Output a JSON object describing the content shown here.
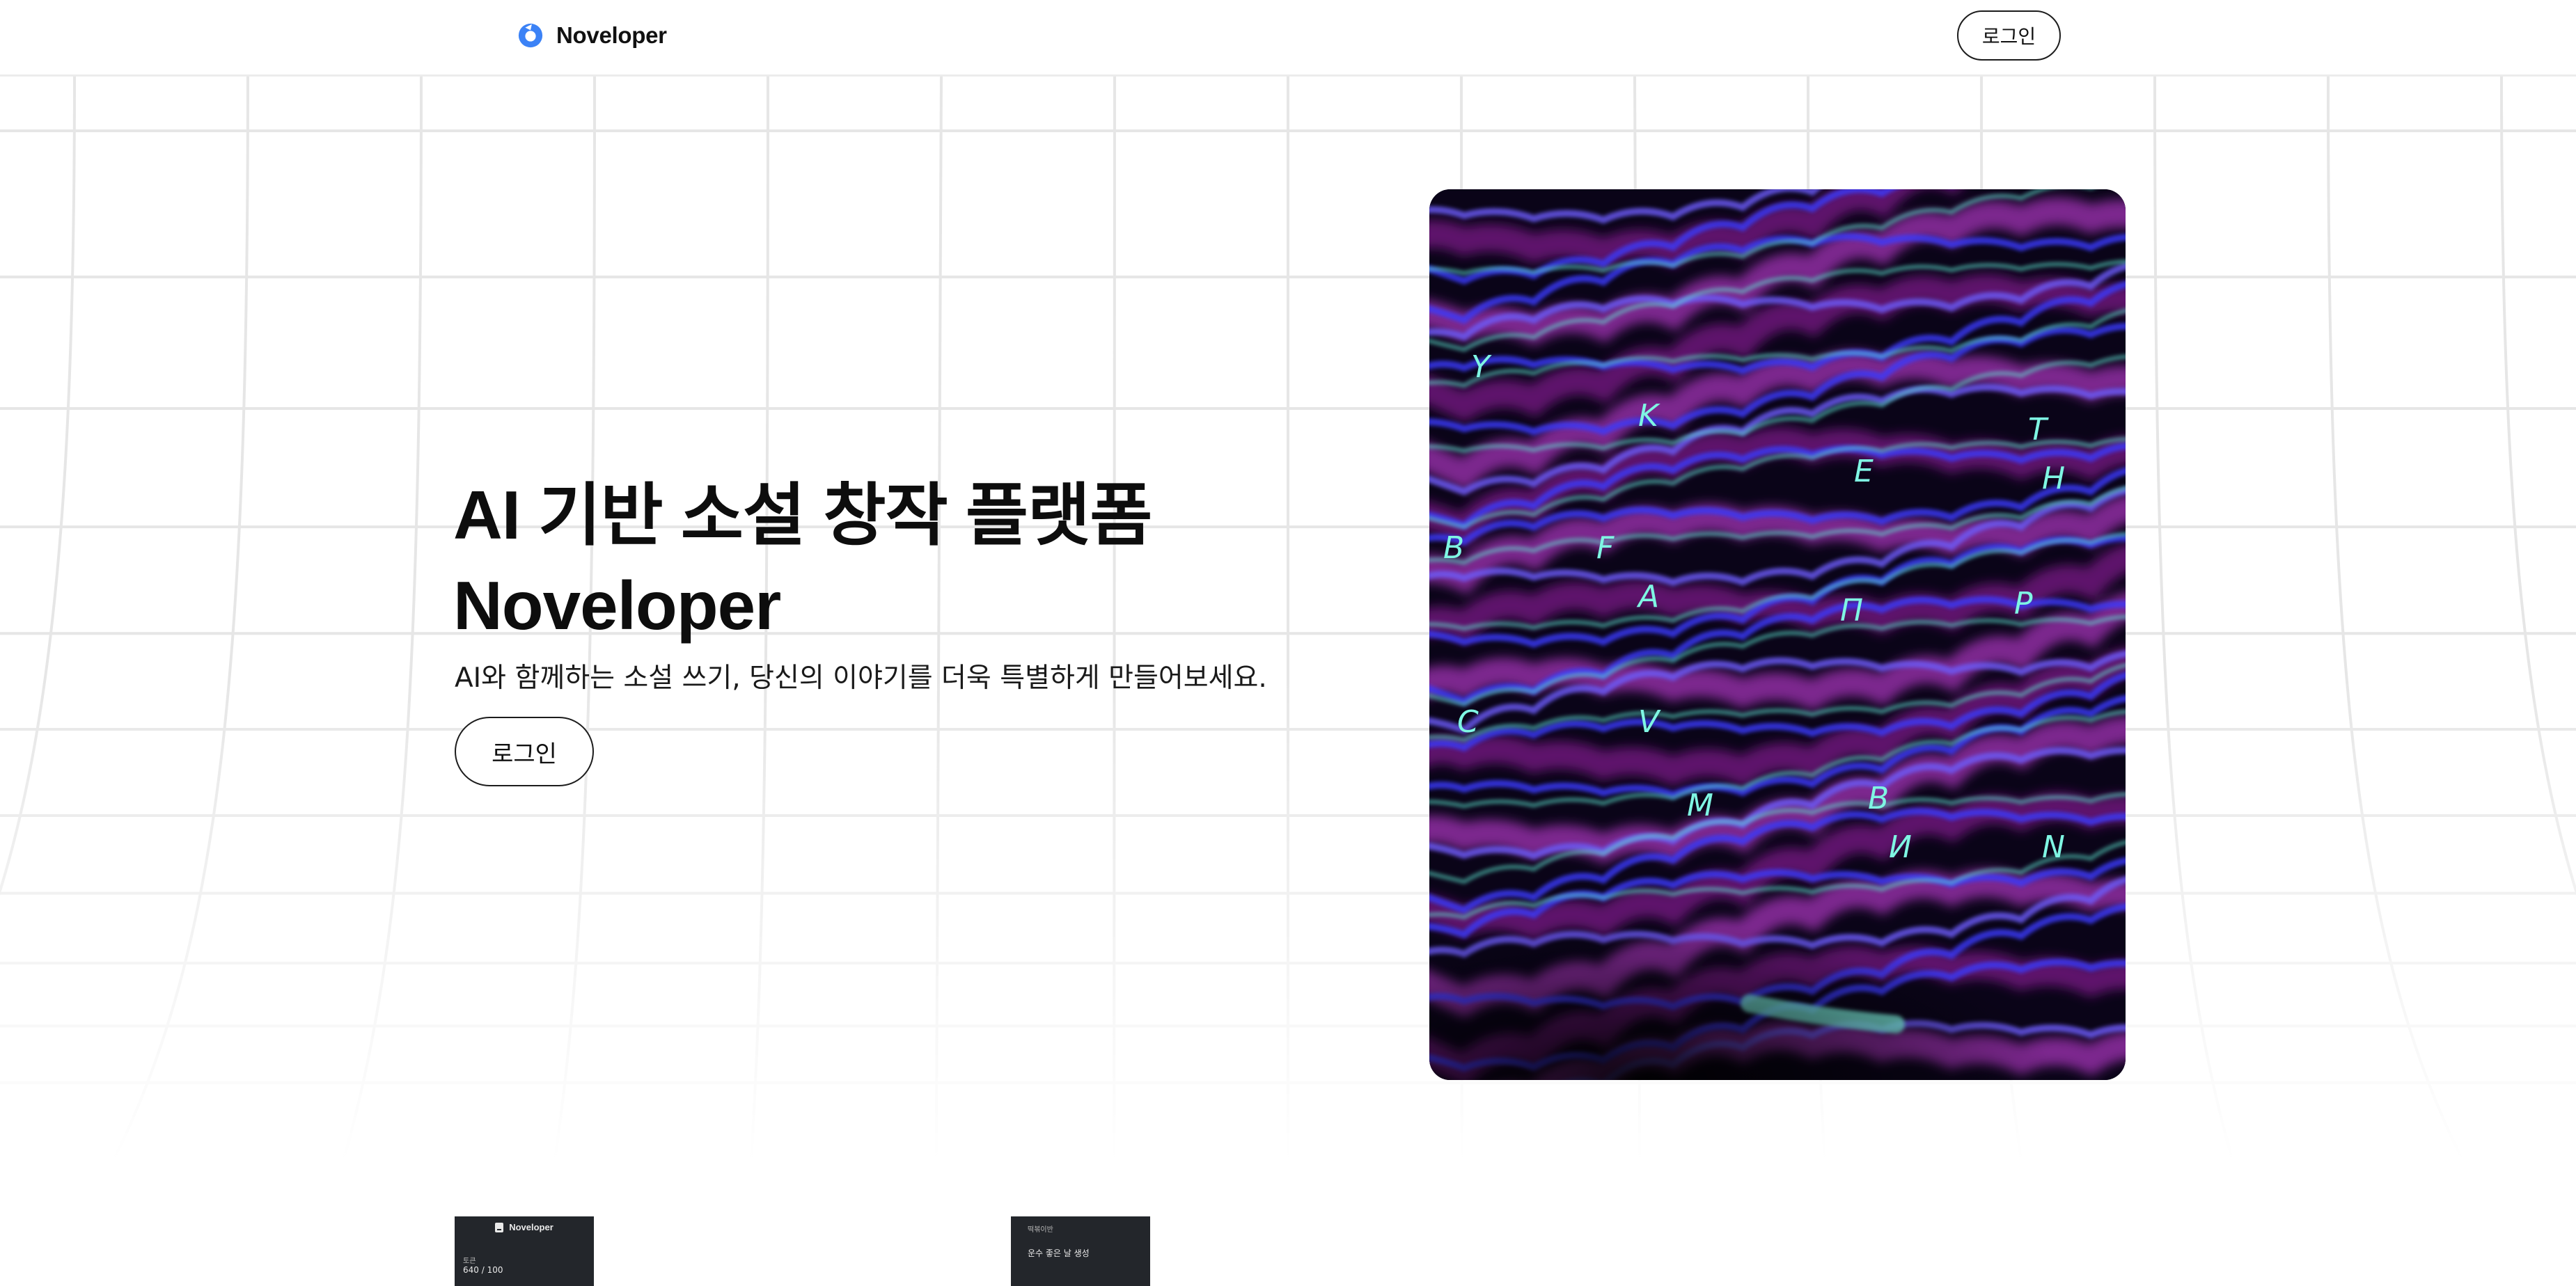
{
  "nav": {
    "brand": "Noveloper",
    "login_label": "로그인"
  },
  "hero": {
    "title_line1": "AI 기반 소설 창작 플랫폼",
    "title_line2": "Noveloper",
    "subtitle": "AI와 함께하는 소설 쓰기, 당신의 이야기를 더욱 특별하게 만들어보세요.",
    "login_label": "로그인",
    "image_letters": [
      "Y",
      "K",
      "E",
      "T",
      "H",
      "B",
      "F",
      "A",
      "П",
      "Р",
      "C",
      "V",
      "M",
      "B",
      "И",
      "N"
    ]
  },
  "preview_left": {
    "brand": "Noveloper",
    "label": "토큰",
    "value": "640 / 100"
  },
  "preview_right": {
    "label": "떡볶이반",
    "value": "운수 좋은 날 생성"
  },
  "colors": {
    "brand_blue": "#3b82f6",
    "preview_bg": "#23262b",
    "grid_line": "#e6e6e6",
    "neon_magenta": "#c026d3",
    "neon_blue": "#3b3bff",
    "neon_cyan": "#5eead4"
  },
  "icons": {
    "brand": "brand-logo-icon",
    "preview_doc": "document-icon"
  }
}
